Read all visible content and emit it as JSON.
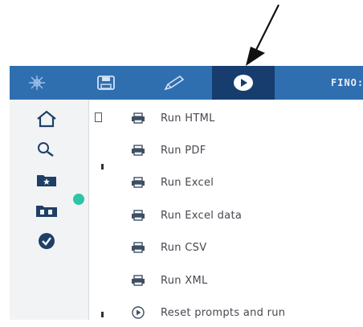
{
  "toolbar": {
    "buttons": [
      {
        "name": "explore-icon"
      },
      {
        "name": "save-icon"
      },
      {
        "name": "edit-icon"
      },
      {
        "name": "run-icon",
        "active": true
      }
    ],
    "trailing_label": "FINO:"
  },
  "sidebar": {
    "items": [
      {
        "name": "home-icon"
      },
      {
        "name": "search-icon"
      },
      {
        "name": "folder-star-icon"
      },
      {
        "name": "team-folder-icon"
      },
      {
        "name": "check-circle-icon"
      }
    ]
  },
  "run_menu": {
    "items": [
      {
        "label": "Run HTML",
        "icon": "printer-icon"
      },
      {
        "label": "Run PDF",
        "icon": "printer-icon"
      },
      {
        "label": "Run Excel",
        "icon": "printer-icon"
      },
      {
        "label": "Run Excel data",
        "icon": "printer-icon"
      },
      {
        "label": "Run CSV",
        "icon": "printer-icon"
      },
      {
        "label": "Run XML",
        "icon": "printer-icon"
      },
      {
        "label": "Reset prompts and run",
        "icon": "reset-play-icon"
      }
    ]
  },
  "colors": {
    "toolbar": "#2f6fb0",
    "toolbar_active": "#163d6e",
    "sidebar_bg": "#f2f3f5",
    "sidebar_icon": "#1f3f66",
    "notification_dot": "#2ec4a6"
  }
}
